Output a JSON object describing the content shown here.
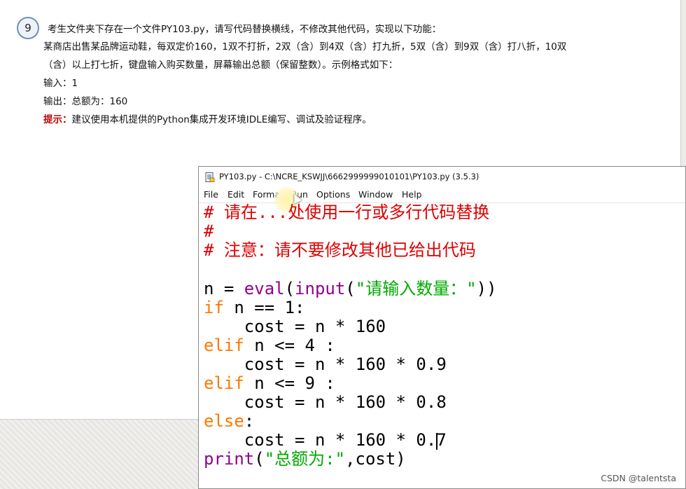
{
  "question": {
    "number": "9",
    "line1": "考生文件夹下存在一个文件PY103.py，请写代码替换横线，不修改其他代码，实现以下功能：",
    "line2": "某商店出售某品牌运动鞋，每双定价160，1双不打折，2双（含）到4双（含）打九折，5双（含）到9双（含）打八折，10双",
    "line3": "（含）以上打七折，键盘输入购买数量，屏幕输出总额（保留整数）。示例格式如下：",
    "input_example": "输入：1",
    "output_example": "输出：总额为：160",
    "hint_label": "提示：",
    "hint_text": "建议使用本机提供的Python集成开发环境IDLE编写、调试及验证程序。"
  },
  "idle_window": {
    "title": "PY103.py - C:\\NCRE_KSWJJ\\6662999999010101\\PY103.py (3.5.3)",
    "icon": "python-file-icon",
    "menu": [
      "File",
      "Edit",
      "Format",
      "Run",
      "Options",
      "Window",
      "Help"
    ]
  },
  "code": {
    "c1": "# 请在...处使用一行或多行代码替换",
    "c2": "#",
    "c3": "# 注意：请不要修改其他已给出代码",
    "l5_a": "n = ",
    "l5_eval": "eval",
    "l5_b": "(",
    "l5_input": "input",
    "l5_c": "(",
    "l5_str": "\"请输入数量：\"",
    "l5_d": "))",
    "l6_kw": "if",
    "l6_rest": " n == 1:",
    "l7": "    cost = n * 160",
    "l8_kw": "elif",
    "l8_rest": " n <= 4 :",
    "l9": "    cost = n * 160 * 0.9",
    "l10_kw": "elif",
    "l10_rest": " n <= 9 :",
    "l11": "    cost = n * 160 * 0.8",
    "l12_kw": "else",
    "l12_rest": ":",
    "l13": "    cost = n * 160 * 0.7",
    "l14_print": "print",
    "l14_a": "(",
    "l14_str": "\"总额为:\"",
    "l14_b": ",cost)"
  },
  "watermark": "CSDN @talentsta"
}
